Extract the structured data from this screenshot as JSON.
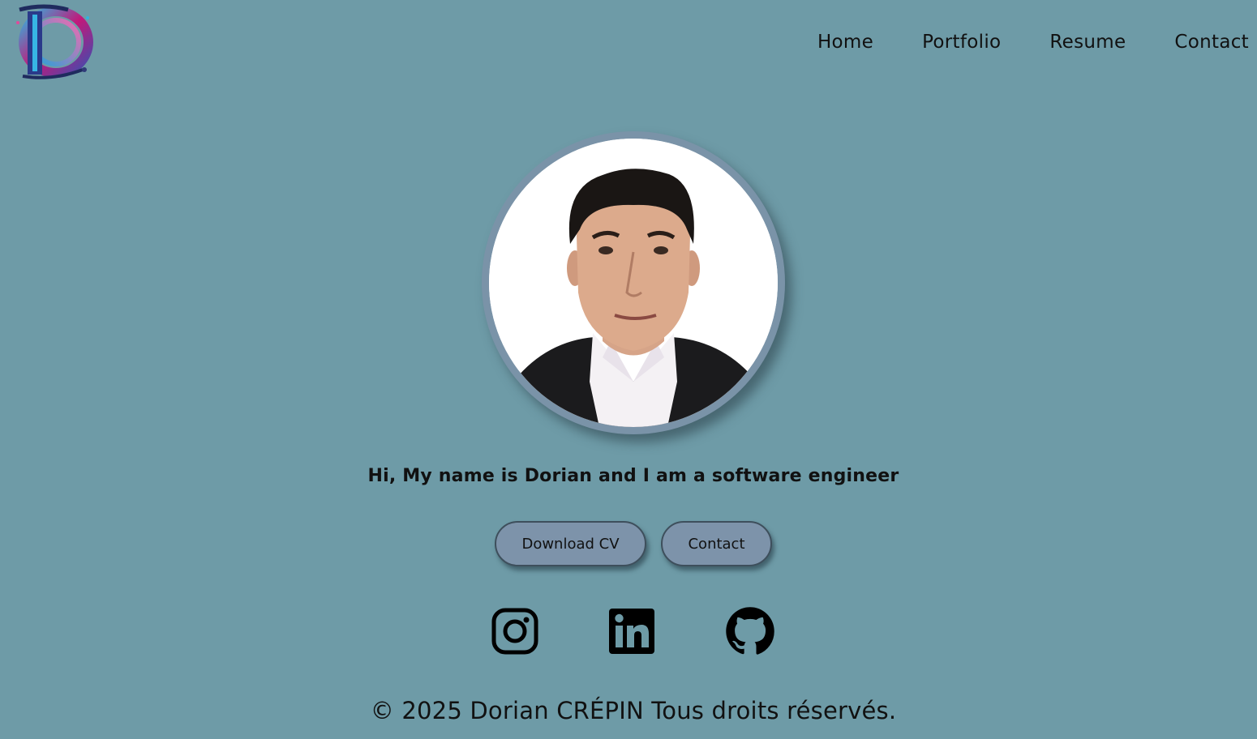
{
  "nav": {
    "items": [
      {
        "label": "Home"
      },
      {
        "label": "Portfolio"
      },
      {
        "label": "Resume"
      },
      {
        "label": "Contact"
      }
    ]
  },
  "hero": {
    "intro": "Hi, My name is Dorian and I am a software engineer"
  },
  "actions": {
    "download_cv_label": "Download CV",
    "contact_label": "Contact"
  },
  "socials": [
    {
      "icon": "instagram-icon"
    },
    {
      "icon": "linkedin-icon"
    },
    {
      "icon": "github-icon"
    }
  ],
  "footer": {
    "copyright": "© 2025 Dorian CRÉPIN Tous droits réservés."
  },
  "colors": {
    "background": "#6e9ba7",
    "button": "#7d93aa",
    "portrait_ring": "#7a93a8"
  }
}
